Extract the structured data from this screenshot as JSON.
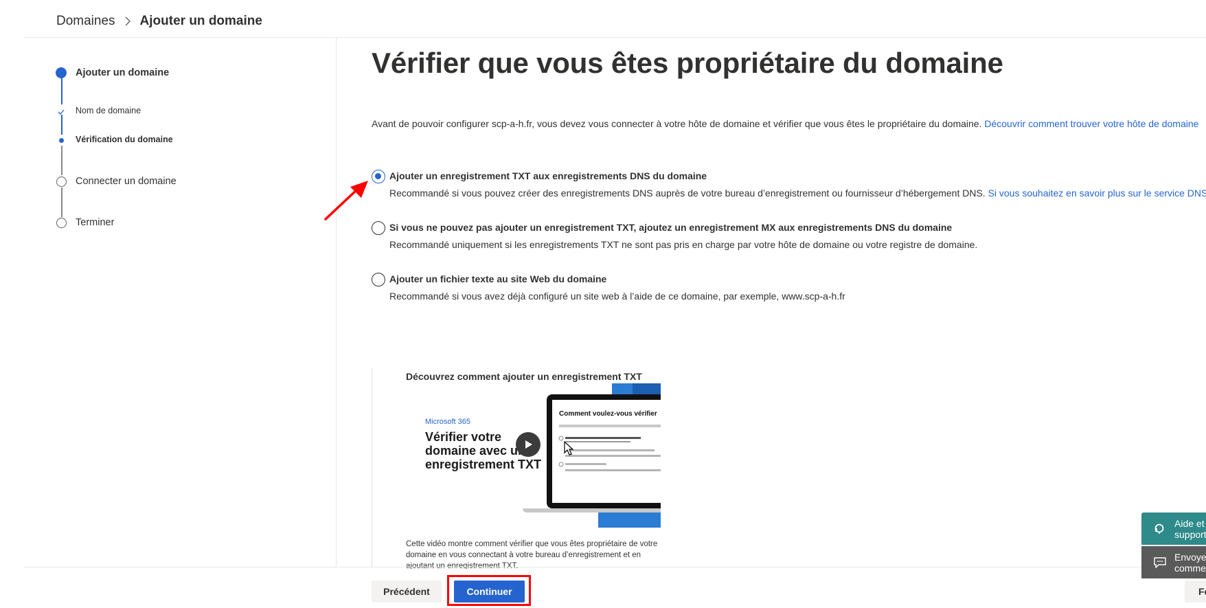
{
  "breadcrumb": {
    "parent": "Domaines",
    "current": "Ajouter un domaine"
  },
  "stepper": {
    "steps": [
      {
        "label": "Ajouter un domaine",
        "state": "current"
      },
      {
        "label": "Nom de domaine",
        "state": "done"
      },
      {
        "label": "Vérification du domaine",
        "state": "current"
      },
      {
        "label": "Connecter un domaine",
        "state": "pending"
      },
      {
        "label": "Terminer",
        "state": "pending"
      }
    ]
  },
  "main": {
    "title": "Vérifier que vous êtes propriétaire du domaine",
    "intro_text": "Avant de pouvoir configurer scp-a-h.fr, vous devez vous connecter à votre hôte de domaine et vérifier que vous êtes le propriétaire du domaine. ",
    "intro_link": "Découvrir comment trouver votre hôte de domaine",
    "options": [
      {
        "title": "Ajouter un enregistrement TXT aux enregistrements DNS du domaine",
        "description": "Recommandé si vous pouvez créer des enregistrements DNS auprès de votre bureau d’enregistrement ou fournisseur d’hébergement DNS. ",
        "link": "Si vous souhaitez en savoir plus sur le service DNS",
        "selected": true
      },
      {
        "title": "Si vous ne pouvez pas ajouter un enregistrement TXT, ajoutez un enregistrement MX aux enregistrements DNS du domaine",
        "description": "Recommandé uniquement si les enregistrements TXT ne sont pas pris en charge par votre hôte de domaine ou votre registre de domaine.",
        "selected": false
      },
      {
        "title": "Ajouter un fichier texte au site Web du domaine",
        "description": "Recommandé si vous avez déjà configuré un site web à l’aide de ce domaine, par exemple, www.scp-a-h.fr",
        "selected": false
      }
    ]
  },
  "video": {
    "title": "Découvrez comment ajouter un enregistrement TXT",
    "thumb_brand": "Microsoft 365",
    "thumb_headline_1": "Vérifier votre",
    "thumb_headline_2": "domaine avec un",
    "thumb_headline_3": "enregistrement TXT",
    "thumb_screen_heading": "Comment voulez-vous vérifier",
    "caption": "Cette vidéo montre comment vérifier que vous êtes propriétaire de votre domaine en vous connectant à votre bureau d’enregistrement et en ajoutant un enregistrement TXT."
  },
  "footer": {
    "prev_label": "Précédent",
    "next_label": "Continuer",
    "close_label": "Fermer"
  },
  "help": {
    "help_label": "Aide et support",
    "feedback_line1": "Envoyer des",
    "feedback_line2": "commentaires"
  },
  "colors": {
    "accent": "#2564cf",
    "annotation": "#ff0000",
    "help": "#2f8a8a"
  }
}
